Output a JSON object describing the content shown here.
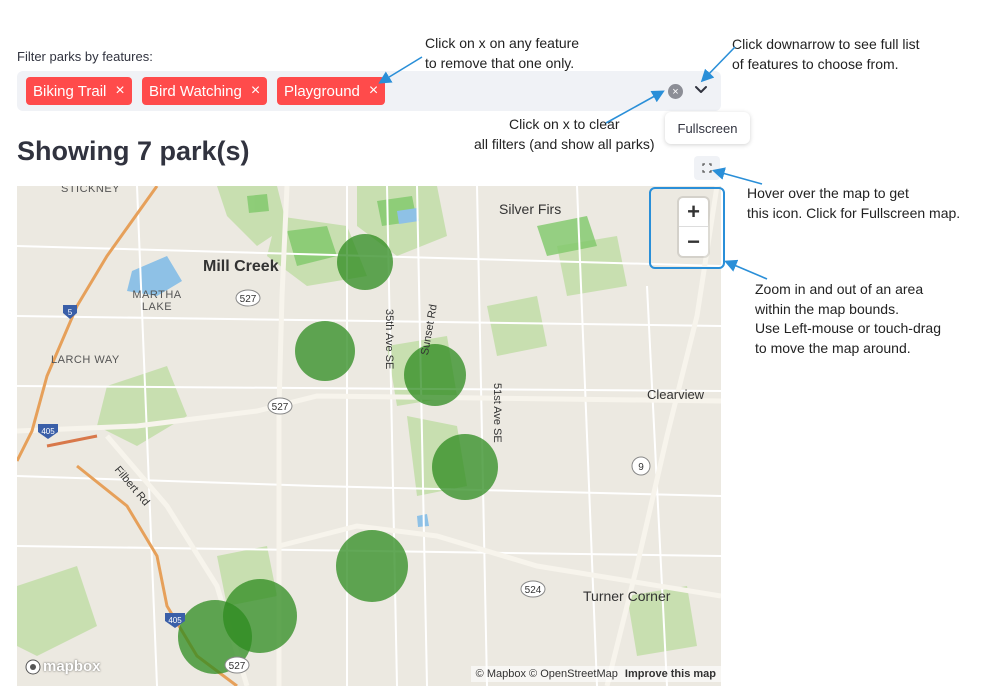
{
  "filter": {
    "label": "Filter parks by features:",
    "chips": [
      {
        "label": "Biking Trail",
        "remove": "×"
      },
      {
        "label": "Bird Watching",
        "remove": "×"
      },
      {
        "label": "Playground",
        "remove": "×"
      }
    ],
    "clear_icon": "×"
  },
  "tooltip": "Fullscreen",
  "heading": "Showing 7 park(s)",
  "map": {
    "labels": {
      "silver_firs": "Silver Firs",
      "mill_creek": "Mill Creek",
      "martha_lake": "MARTHA LAKE",
      "larch_way": "LARCH WAY",
      "stickney": "STICKNEY",
      "clearview": "Clearview",
      "filbert_rd": "Filbert Rd",
      "turner_corner": "Turner Corner",
      "ave35": "35th Ave SE",
      "sunset_rd": "Sunset Rd",
      "ave51": "51st Ave SE"
    },
    "shields": {
      "r527a": "527",
      "r527b": "527",
      "r527c": "527",
      "r5": "5",
      "r405a": "405",
      "r405b": "405",
      "r9": "9",
      "r524": "524"
    },
    "zoom_in": "+",
    "zoom_out": "−",
    "logo": "mapbox",
    "attribution": {
      "mapbox": "© Mapbox",
      "osm": "© OpenStreetMap",
      "improve": "Improve this map"
    },
    "accent_circle_color": "#2e8b1f"
  },
  "annotations": {
    "remove_one": [
      "Click on x on any feature",
      "to remove that one only."
    ],
    "full_list": [
      "Click downarrow to see full list",
      "of features to choose from."
    ],
    "clear_all": [
      "Click on x to clear",
      "all filters (and show all parks)"
    ],
    "fullscreen": [
      "Hover over the map to get",
      "this icon. Click for Fullscreen map."
    ],
    "zoom": [
      "Zoom in and out of an area",
      "within the map bounds.",
      "Use Left-mouse or touch-drag",
      "to move the map around."
    ]
  },
  "colors": {
    "chip": "#ff4b4b",
    "annotation_arrow": "#2a8fd8",
    "map_background": "#ece9e1"
  }
}
